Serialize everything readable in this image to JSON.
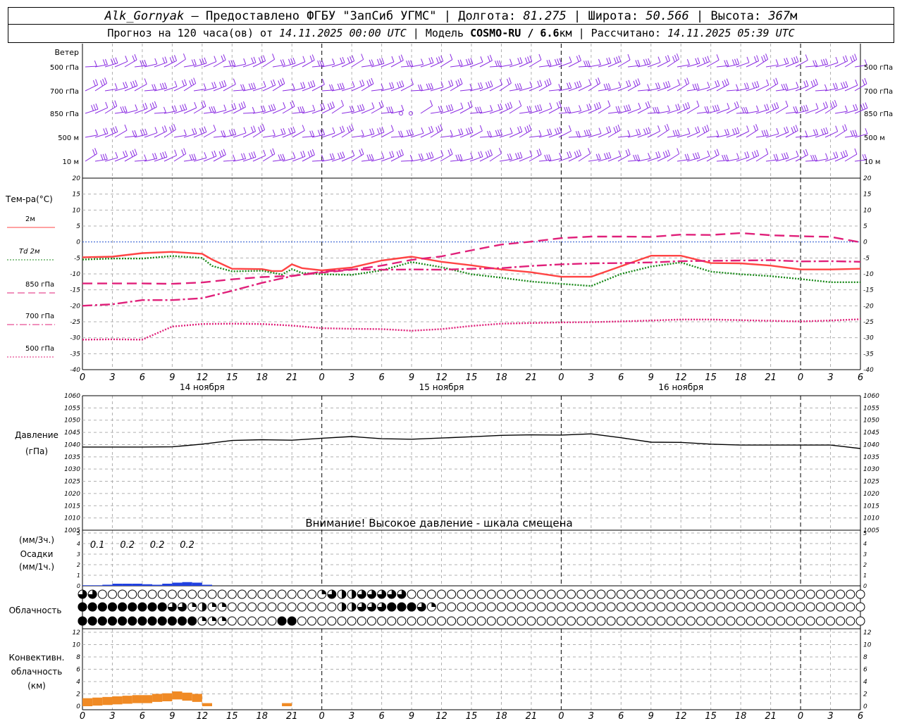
{
  "header": {
    "station": "Alk_Gornyak",
    "provider": " — Предоставлено ФГБУ \"ЗапСиб УГМС\" | ",
    "lon_label": "Долгота: ",
    "lon": "81.275",
    "lat_label": " | Широта: ",
    "lat": "50.566",
    "alt_label": " | Высота: ",
    "alt": "367",
    "alt_unit": "м",
    "fc_label": "Прогноз на 120 часа(ов) от ",
    "fc_time": "14.11.2025 00:00 UTC",
    "model_label": " | Модель ",
    "model": "COSMO-RU / 6.6",
    "model_unit": "км",
    "calc_label": " | Рассчитано: ",
    "calc_time": "14.11.2025 05:39 UTC"
  },
  "wind": {
    "title": "Ветер",
    "levels": [
      "500 гПа",
      "700 гПа",
      "850 гПа",
      "500 м",
      "10  м"
    ],
    "color": "#8a2be2"
  },
  "temperature": {
    "title": "Тем-ра(°С)",
    "legend": [
      {
        "label": "2м",
        "color": "#ff4444",
        "style": "solid"
      },
      {
        "label": "Td  2м",
        "color": "#1a8a1a",
        "style": "dotted"
      },
      {
        "label": "850 гПа",
        "color": "#e0207a",
        "style": "longdash"
      },
      {
        "label": "700 гПа",
        "color": "#e0207a",
        "style": "dashdot"
      },
      {
        "label": "500 гПа",
        "color": "#e0207a",
        "style": "dotted"
      }
    ],
    "ticks": [
      20,
      15,
      10,
      5,
      0,
      -5,
      -10,
      -15,
      -20,
      -25,
      -30,
      -35,
      -40
    ]
  },
  "time_axis": {
    "hour_labels": [
      "0",
      "3",
      "6",
      "9",
      "12",
      "15",
      "18",
      "21",
      "0",
      "3",
      "6",
      "9",
      "12",
      "15",
      "18",
      "21",
      "0",
      "3",
      "6",
      "9",
      "12",
      "15",
      "18",
      "21",
      "0",
      "3",
      "6"
    ],
    "days": [
      "14 ноября",
      "15 ноября",
      "16 ноября"
    ]
  },
  "pressure": {
    "title1": "Давление",
    "title2": "(гПа)",
    "ticks": [
      1060,
      1055,
      1050,
      1045,
      1040,
      1035,
      1030,
      1025,
      1020,
      1015,
      1010,
      1005
    ],
    "warning": "Внимание! Высокое давление - шкала смещена"
  },
  "precip": {
    "label1": "(мм/3ч.)",
    "label2": "Осадки",
    "label3": "(мм/1ч.)",
    "ticks": [
      5,
      4,
      3,
      2,
      1,
      0
    ],
    "amounts": [
      "0.1",
      "0.2",
      "0.2",
      "0.2"
    ],
    "color": "#2040e0"
  },
  "clouds": {
    "title": "Облачность",
    "rows": [
      [
        75,
        75,
        0,
        0,
        0,
        0,
        0,
        0,
        0,
        0,
        0,
        0,
        0,
        0,
        0,
        0,
        0,
        0,
        0,
        0,
        0,
        0,
        0,
        0,
        25,
        75,
        50,
        50,
        75,
        75,
        75,
        75,
        75,
        0,
        0,
        0,
        0,
        0,
        0,
        0,
        0,
        0,
        0,
        0,
        0,
        0,
        0,
        0,
        0,
        0,
        0,
        0,
        0,
        0,
        0,
        0,
        0,
        0,
        0,
        0,
        0,
        0,
        0,
        0,
        0,
        0,
        0,
        0,
        0,
        0,
        0,
        0,
        0,
        0,
        0,
        0,
        0,
        0,
        0,
        0,
        0
      ],
      [
        100,
        100,
        100,
        100,
        100,
        100,
        100,
        100,
        100,
        75,
        75,
        25,
        50,
        25,
        25,
        0,
        0,
        0,
        0,
        0,
        0,
        0,
        0,
        0,
        0,
        0,
        50,
        50,
        75,
        75,
        75,
        100,
        100,
        100,
        75,
        25,
        0,
        0,
        0,
        0,
        0,
        0,
        0,
        0,
        0,
        0,
        0,
        0,
        0,
        0,
        0,
        0,
        0,
        0,
        0,
        0,
        0,
        0,
        0,
        0,
        0,
        0,
        0,
        0,
        0,
        0,
        0,
        0,
        0,
        0,
        0,
        0,
        0,
        0,
        0,
        0,
        0,
        0,
        0,
        0,
        0
      ],
      [
        100,
        100,
        100,
        100,
        100,
        100,
        100,
        100,
        100,
        100,
        100,
        100,
        25,
        25,
        25,
        0,
        0,
        0,
        0,
        0,
        100,
        100,
        0,
        0,
        0,
        0,
        0,
        0,
        0,
        0,
        0,
        0,
        0,
        0,
        0,
        0,
        0,
        0,
        0,
        0,
        0,
        0,
        0,
        0,
        0,
        0,
        0,
        0,
        0,
        0,
        0,
        0,
        0,
        0,
        0,
        0,
        0,
        0,
        0,
        0,
        0,
        0,
        0,
        0,
        0,
        0,
        0,
        0,
        0,
        0,
        0,
        0,
        0,
        0,
        0,
        0,
        0,
        0,
        0,
        0,
        0
      ]
    ]
  },
  "convective": {
    "title1": "Конвективн.",
    "title2": "облачность",
    "title3": "(км)",
    "ticks": [
      12,
      10,
      8,
      6,
      4,
      2,
      0
    ],
    "color": "#f08a24"
  },
  "chart_data": [
    {
      "type": "line",
      "title": "Тем-ра(°С)",
      "x_unit": "hours since 14.11.2025 00:00 UTC",
      "ylim": [
        -40,
        20
      ],
      "series": [
        {
          "name": "2м",
          "x": [
            0,
            3,
            6,
            9,
            12,
            13,
            15,
            18,
            19,
            20,
            21,
            22,
            24,
            27,
            30,
            33,
            36,
            39,
            42,
            45,
            48,
            51,
            54,
            57,
            60,
            63,
            66,
            69,
            72,
            75,
            78
          ],
          "values": [
            -4.8,
            -4.6,
            -3.5,
            -3.1,
            -3.7,
            -5.5,
            -8.4,
            -8.5,
            -9.1,
            -9.1,
            -7.0,
            -8.2,
            -8.9,
            -8.0,
            -5.8,
            -4.6,
            -6.2,
            -7.3,
            -8.6,
            -9.5,
            -10.9,
            -10.9,
            -7.6,
            -4.3,
            -4.3,
            -6.6,
            -6.7,
            -7.4,
            -8.6,
            -8.6,
            -8.4
          ]
        },
        {
          "name": "Td  2м",
          "x": [
            0,
            3,
            6,
            9,
            12,
            13,
            15,
            18,
            20,
            21,
            22,
            24,
            27,
            30,
            33,
            36,
            39,
            42,
            45,
            48,
            51,
            54,
            57,
            60,
            63,
            66,
            69,
            72,
            75,
            78
          ],
          "values": [
            -5.5,
            -5.2,
            -5.2,
            -4.4,
            -5.0,
            -7.5,
            -9.2,
            -9.0,
            -10.2,
            -8.5,
            -9.7,
            -10.1,
            -10.3,
            -8.9,
            -6.3,
            -7.9,
            -10.1,
            -11.2,
            -12.4,
            -13.1,
            -13.8,
            -10.0,
            -7.7,
            -6.4,
            -9.3,
            -10.1,
            -10.7,
            -11.6,
            -12.6,
            -12.6
          ]
        },
        {
          "name": "850 гПа",
          "x": [
            0,
            3,
            6,
            9,
            12,
            15,
            18,
            21,
            24,
            27,
            30,
            33,
            36,
            39,
            42,
            45,
            48,
            51,
            54,
            57,
            60,
            63,
            66,
            69,
            72,
            75,
            78
          ],
          "values": [
            -13.0,
            -13.0,
            -13.0,
            -13.1,
            -12.7,
            -11.7,
            -11.0,
            -10.6,
            -9.6,
            -8.7,
            -7.4,
            -5.6,
            -4.5,
            -2.6,
            -0.8,
            0.1,
            1.2,
            1.7,
            1.7,
            1.6,
            2.3,
            2.2,
            2.8,
            2.1,
            1.8,
            1.6,
            -0.1
          ]
        },
        {
          "name": "700 гПа",
          "x": [
            0,
            3,
            6,
            9,
            12,
            15,
            18,
            21,
            24,
            27,
            30,
            33,
            36,
            39,
            42,
            45,
            48,
            51,
            54,
            57,
            60,
            63,
            66,
            69,
            72,
            75,
            78
          ],
          "values": [
            -20.0,
            -19.5,
            -18.2,
            -18.2,
            -17.6,
            -15.3,
            -12.8,
            -10.7,
            -9.3,
            -8.6,
            -8.7,
            -8.6,
            -8.7,
            -8.4,
            -8.2,
            -7.5,
            -7.0,
            -6.7,
            -6.6,
            -6.4,
            -6.0,
            -5.9,
            -5.8,
            -5.7,
            -6.1,
            -6.0,
            -6.2
          ]
        },
        {
          "name": "500 гПа",
          "x": [
            0,
            3,
            6,
            9,
            12,
            15,
            18,
            21,
            24,
            27,
            30,
            33,
            36,
            39,
            42,
            45,
            48,
            51,
            54,
            57,
            60,
            63,
            66,
            69,
            72,
            75,
            78
          ],
          "values": [
            -30.6,
            -30.5,
            -30.6,
            -26.5,
            -25.7,
            -25.6,
            -25.7,
            -26.2,
            -27.0,
            -27.2,
            -27.3,
            -27.8,
            -27.3,
            -26.3,
            -25.6,
            -25.4,
            -25.2,
            -25.1,
            -24.9,
            -24.6,
            -24.3,
            -24.3,
            -24.5,
            -24.7,
            -24.9,
            -24.6,
            -24.2
          ]
        }
      ]
    },
    {
      "type": "line",
      "title": "Давление",
      "ylabel": "(гПа)",
      "ylim": [
        1005,
        1060
      ],
      "series": [
        {
          "name": "Давление",
          "x": [
            0,
            3,
            6,
            9,
            12,
            15,
            18,
            21,
            24,
            27,
            30,
            33,
            36,
            39,
            42,
            45,
            48,
            51,
            54,
            57,
            60,
            63,
            66,
            69,
            72,
            75,
            78
          ],
          "values": [
            1039.0,
            1039.0,
            1039.0,
            1039.1,
            1040.2,
            1041.7,
            1042.0,
            1041.8,
            1042.6,
            1043.3,
            1042.4,
            1042.2,
            1042.7,
            1043.2,
            1043.8,
            1044.0,
            1043.9,
            1044.4,
            1042.8,
            1041.0,
            1040.9,
            1040.2,
            1039.8,
            1039.8,
            1039.8,
            1039.8,
            1038.4
          ]
        }
      ]
    },
    {
      "type": "bar",
      "title": "Осадки",
      "ylabel": "(мм/1ч.)",
      "ylim": [
        0,
        5
      ],
      "x": [
        0,
        1,
        2,
        3,
        4,
        5,
        6,
        7,
        8,
        9,
        10,
        11,
        12
      ],
      "values": [
        0.05,
        0.05,
        0.1,
        0.2,
        0.2,
        0.2,
        0.15,
        0.1,
        0.2,
        0.3,
        0.35,
        0.3,
        0.1
      ]
    },
    {
      "type": "bar",
      "title": "Конвективн. облачность",
      "ylabel": "(км)",
      "ylim": [
        0,
        12
      ],
      "x": [
        0,
        1,
        2,
        3,
        4,
        5,
        6,
        7,
        8,
        9,
        10,
        11,
        12,
        20
      ],
      "values": [
        1.3,
        1.4,
        1.5,
        1.6,
        1.7,
        1.8,
        1.8,
        2.0,
        2.1,
        2.4,
        2.2,
        2.0,
        0.5,
        0.5
      ]
    }
  ]
}
